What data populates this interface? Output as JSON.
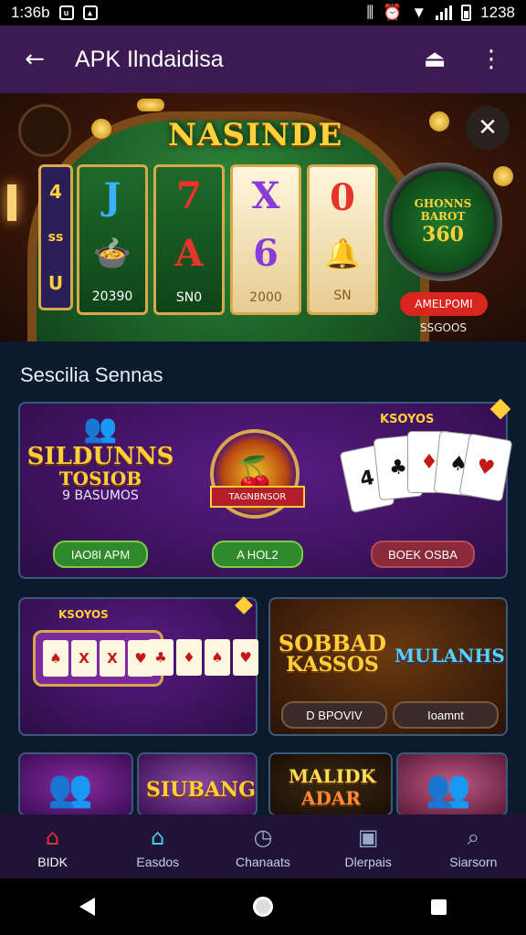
{
  "status_bar": {
    "time": "1:36b",
    "clock_right": "1238"
  },
  "app_bar": {
    "title": "APK Ilndaidisa"
  },
  "hero": {
    "title": "NASINDE",
    "left_panel": [
      "4",
      "ss",
      "U"
    ],
    "reels": [
      {
        "top": "J",
        "bottom_symbol": "food",
        "amount": "20390",
        "color": "#3ab0ff"
      },
      {
        "top": "7",
        "bottom": "A",
        "amount": "SN0",
        "color": "#e8342a"
      },
      {
        "top": "X",
        "bottom": "6",
        "amount": "2000",
        "color": "#8a3ad8"
      },
      {
        "top": "0",
        "bottom_symbol": "bell",
        "amount": "SN",
        "color": "#e8342a"
      }
    ],
    "wheel": {
      "line1": "GHONNS",
      "line2": "BAROT",
      "line3": "360"
    },
    "button": "AMELPOMI",
    "subtext": "SSGOOS"
  },
  "section": {
    "title": "Sescilia Sennas"
  },
  "featured": {
    "tile1": {
      "title_line1": "SILDUNNS",
      "title_line2": "TOSIOB",
      "subtitle": "9 BASUMOS",
      "button": "IAO8I APM"
    },
    "tile2": {
      "banner": "TAGNBNSOR",
      "button": "A HOL2"
    },
    "tile3": {
      "label": "KSOYOS",
      "button": "BOEK OSBA"
    }
  },
  "card_slots": {
    "label": "KSOYOS"
  },
  "card_sobad": {
    "title_line1": "SOBBAD",
    "title_line2": "KASSOS",
    "title2": "MULANHS",
    "button1": "D BPOVIV",
    "button2": "Ioamnt"
  },
  "bottom_tiles": [
    {
      "title": ""
    },
    {
      "title": "SIUBANG"
    },
    {
      "title_line1": "MALIDK",
      "title_line2": "ADAR"
    },
    {
      "title": ""
    }
  ],
  "bottom_nav": [
    {
      "label": "BIDK",
      "icon": "home-icon",
      "active": true
    },
    {
      "label": "Easdos",
      "icon": "house-icon",
      "active": false
    },
    {
      "label": "Chanaats",
      "icon": "clock-icon",
      "active": false
    },
    {
      "label": "Dlerpais",
      "icon": "calendar-icon",
      "active": false
    },
    {
      "label": "Siarsorn",
      "icon": "search-icon",
      "active": false
    }
  ],
  "colors": {
    "app_bar": "#3d1b52",
    "background": "#0d1a2e",
    "accent_gold": "#ffcf3a",
    "active_nav": "#e83030"
  }
}
